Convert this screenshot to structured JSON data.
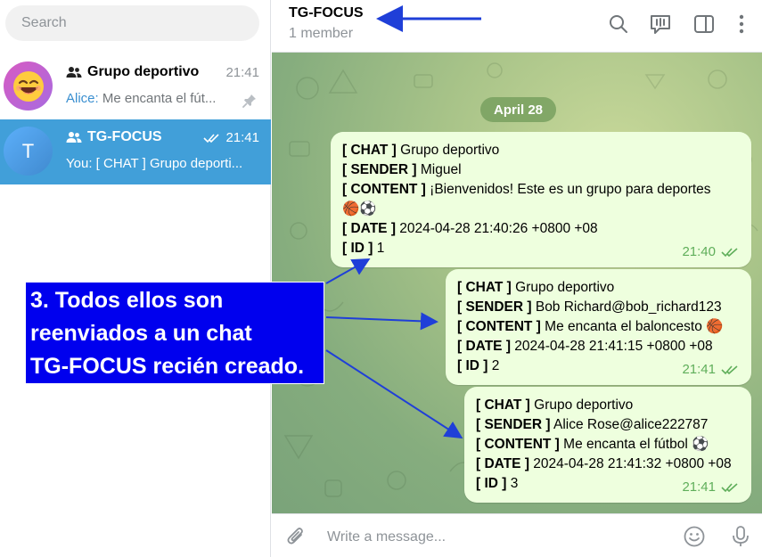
{
  "sidebar": {
    "search_placeholder": "Search",
    "chats": [
      {
        "title": "Grupo deportivo",
        "time": "21:41",
        "sender": "Alice:",
        "preview": " Me encanta el fút...",
        "avatar_icon": "smiling-face-emoji",
        "pinned": true
      },
      {
        "title": "TG-FOCUS",
        "time": "21:41",
        "avatar_letter": "T",
        "sender": "You:",
        "preview": " [ CHAT ] Grupo deporti...",
        "selected": true
      }
    ]
  },
  "header": {
    "title": "TG-FOCUS",
    "subtitle": "1 member",
    "icons": [
      "search-icon",
      "voice-chat-icon",
      "sidebar-toggle-icon",
      "more-vert-icon"
    ]
  },
  "chat": {
    "date": "April 28",
    "messages": [
      {
        "chat_key": "[ CHAT ]",
        "chat_val": " Grupo deportivo",
        "sender_key": "[ SENDER ]",
        "sender_val": " Miguel",
        "content_key": "[ CONTENT ]",
        "content_val": " ¡Bienvenidos! Este es un grupo para deportes",
        "content_emoji": "🏀⚽",
        "date_key": "[ DATE ]",
        "date_val": " 2024-04-28 21:40:26 +0800 +08",
        "id_key": "[ ID ]",
        "id_val": " 1",
        "time": "21:40"
      },
      {
        "chat_key": "[ CHAT ]",
        "chat_val": " Grupo deportivo",
        "sender_key": "[ SENDER ]",
        "sender_val": " Bob Richard@bob_richard123",
        "content_key": "[ CONTENT ]",
        "content_val": " Me encanta el baloncesto 🏀",
        "date_key": "[ DATE ]",
        "date_val": " 2024-04-28 21:41:15 +0800 +08",
        "id_key": "[ ID ]",
        "id_val": " 2",
        "time": "21:41"
      },
      {
        "chat_key": "[ CHAT ]",
        "chat_val": " Grupo deportivo",
        "sender_key": "[ SENDER ]",
        "sender_val": " Alice Rose@alice222787",
        "content_key": "[ CONTENT ]",
        "content_val": " Me encanta el fútbol ⚽",
        "date_key": "[ DATE ]",
        "date_val": " 2024-04-28 21:41:32 +0800 +08",
        "id_key": "[ ID ]",
        "id_val": " 3",
        "time": "21:41"
      }
    ]
  },
  "composer": {
    "placeholder": "Write a message...",
    "icons": [
      "attach-icon",
      "emoji-icon",
      "microphone-icon"
    ]
  },
  "annotation": {
    "text_line1": "3. Todos ellos son",
    "text_line2": "reenviados a un chat",
    "text_line3": "TG-FOCUS recién creado.",
    "color": "#0000ee"
  },
  "colors": {
    "accent": "#419fd9",
    "bubble": "#eeffde",
    "check": "#5fae5a"
  }
}
